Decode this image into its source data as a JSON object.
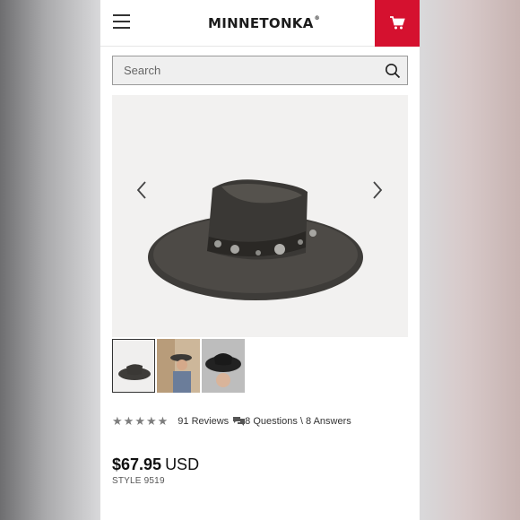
{
  "header": {
    "brand": "MINNETONKA",
    "brand_mark": "®",
    "menu_icon": "hamburger-menu-icon",
    "cart_icon": "shopping-cart-icon",
    "accent_color": "#d5112f"
  },
  "search": {
    "placeholder": "Search",
    "icon": "search-icon"
  },
  "gallery": {
    "prev_icon": "chevron-left-icon",
    "next_icon": "chevron-right-icon",
    "thumbnail_count": 3
  },
  "rating": {
    "stars": 5,
    "reviews_label": "91 Reviews",
    "qa_icon": "speech-bubbles-icon",
    "qa_label": "8 Questions \\ 8 Answers"
  },
  "product": {
    "price": "$67.95",
    "currency": "USD",
    "style": "STYLE 9519"
  }
}
